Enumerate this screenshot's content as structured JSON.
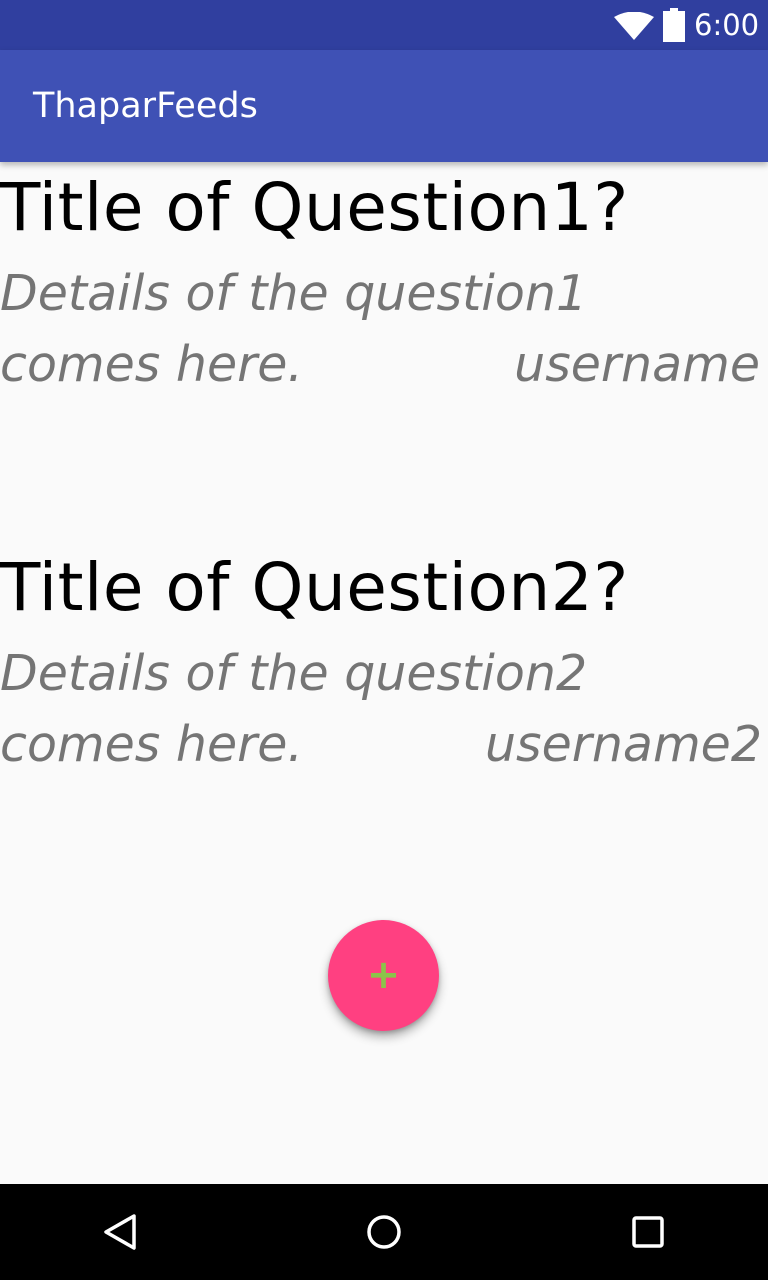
{
  "status_bar": {
    "time": "6:00",
    "wifi_icon": "wifi-icon",
    "battery_icon": "battery-icon",
    "background": "#303F9F"
  },
  "app_bar": {
    "title": "ThaparFeeds",
    "background": "#3F51B5"
  },
  "questions": [
    {
      "title": "Title of Question1?",
      "details_line1": "Details of the question1",
      "details_line2": "comes here.",
      "username": "username"
    },
    {
      "title": "Title of Question2?",
      "details_line1": "Details of the question2",
      "details_line2": "comes here.",
      "username": "username2"
    }
  ],
  "fab": {
    "label": "+",
    "icon": "plus-icon",
    "background": "#FF4081",
    "icon_color": "#8BC34A"
  },
  "nav_bar": {
    "back_icon": "back-icon",
    "home_icon": "home-icon",
    "recents_icon": "recents-icon"
  }
}
